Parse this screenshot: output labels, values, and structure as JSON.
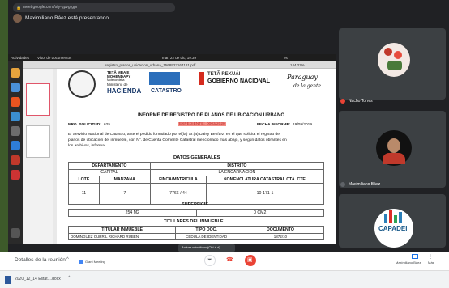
{
  "browser": {
    "url": "meet.google.com/sty-qpvg-gpr"
  },
  "presenter": {
    "text": "Maximiliano Báez está presentando"
  },
  "ubuntu": {
    "activities": "Actividades",
    "app": "Visor de documentos",
    "clock": "mar, 22 de dic, 19:39",
    "lang": "es"
  },
  "viewer": {
    "filename": "registro_planos_ubicacion_urbana_1568923164181.pdf",
    "zoom": "144,27%"
  },
  "document": {
    "logo_left_1": "TETÃ MBA'E",
    "logo_left_2": "MOHENDAPY",
    "logo_left_3": "Motenondeha",
    "logo_left_4": "Ministerio de",
    "hacienda": "HACIENDA",
    "catastro": "CATASTRO",
    "tetao": "TETÃ REKUÁI",
    "gobierno": "GOBIERNO NACIONAL",
    "paraguay": "Paraguay",
    "dela": "de la gente",
    "title": "INFORME DE REGISTRO DE PLANOS DE UBICACIÓN URBANO",
    "nro_label": "NRO. SOLICITUD:",
    "nro_value": "625",
    "exp_label": "EXPEDIENTE:",
    "exp_value": "0003/2020",
    "fecha_label": "FECHA INFORME:",
    "fecha_value": "19/09/2019",
    "body1": "El Servicio Nacional de Catastro, ante el pedido formulado por el(la) Sr.(a) Daisy Benítez, en el que solicita el registro de",
    "body2": "planos de ubicación del inmueble, con N°. de Cuenta Corriente Catastral mencionado más abajo, y según datos obrantes en",
    "body3": "los archivos, informa:",
    "datos_generales": "DATOS GENERALES",
    "col_departamento": "DEPARTAMENTO",
    "col_distrito": "DISTRITO",
    "val_departamento": "CAPITAL",
    "val_distrito": "LA ENCARNACION",
    "col_lote": "LOTE",
    "col_manzana": "MANZANA",
    "col_finca": "FINCA/MATRICULA",
    "col_nomen": "NOMENCLATURA CATASTRAL CTA. CTE.",
    "val_lote": "11",
    "val_manzana": "7",
    "val_finca": "7766 / 44",
    "val_nomen": "10-171-1",
    "superficie": "SUPERFICIE",
    "sup_1": "254 M2",
    "sup_2": "0 CM2",
    "titulares": "TITULARES DEL INMUEBLE",
    "col_titular": "TITULAR INMUEBLE",
    "col_tipo": "TIPO DOC.",
    "col_documento": "DOCUMENTO",
    "val_titular": "DOMINGUEZ CURRIL RICHARD RUBEN",
    "val_tipo": "CEDULA DE IDENTIDAD",
    "val_documento": "1872/10"
  },
  "participants": [
    {
      "name": "Nacho Torres"
    },
    {
      "name": "Maximiliano Báez"
    },
    {
      "name": "CAPADEI"
    }
  ],
  "bottom": {
    "details": "Detalles de la reunión",
    "tooltip": "Activar micrófono (Ctrl + d)",
    "giant_meeting": "Giant Meeting",
    "presenter_label": "Maximiliano Báez",
    "more_label": "Más"
  },
  "downloads": {
    "file": "2020_12_14 Estat....docx"
  },
  "colors": {
    "red_button": "#ea4335",
    "meet_bg": "#202124",
    "highlight": "#f28b82"
  }
}
